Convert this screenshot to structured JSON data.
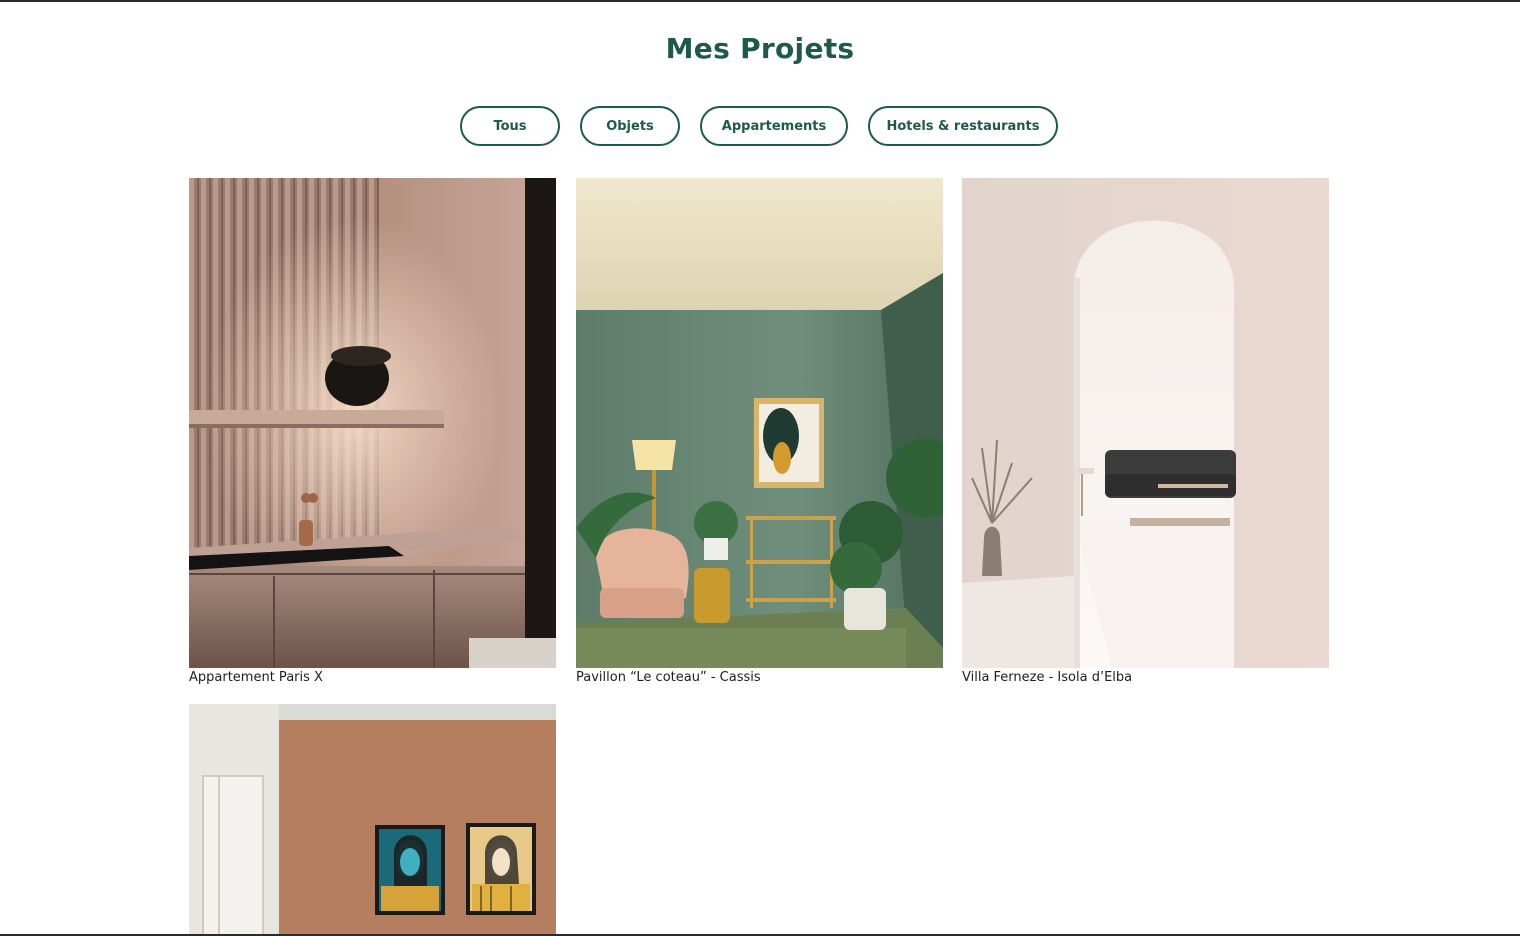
{
  "page": {
    "title": "Mes Projets"
  },
  "filters": [
    {
      "label": "Tous"
    },
    {
      "label": "Objets"
    },
    {
      "label": "Appartements"
    },
    {
      "label": "Hotels & restaurants"
    }
  ],
  "projects": [
    {
      "caption": "Appartement Paris X"
    },
    {
      "caption": "Pavillon “Le coteau” - Cassis"
    },
    {
      "caption": "Villa Ferneze - Isola d’Elba"
    },
    {
      "caption": ""
    }
  ],
  "colors": {
    "accent": "#1d5a4a",
    "text": "#1e1e1e",
    "background": "#ffffff"
  }
}
